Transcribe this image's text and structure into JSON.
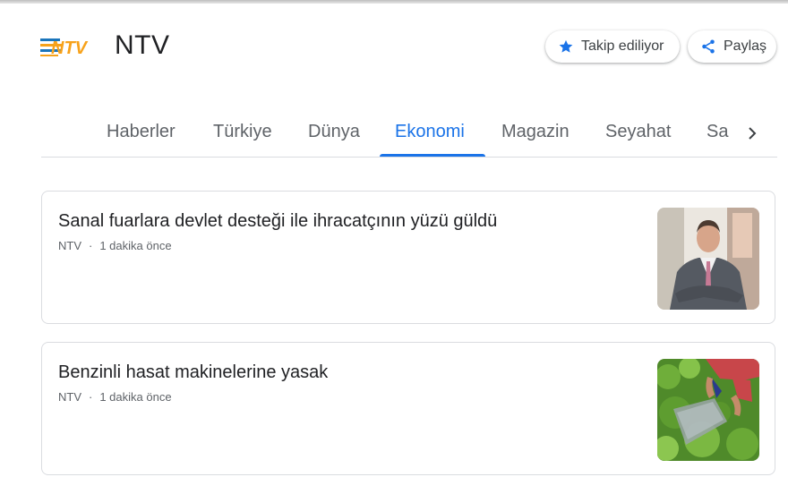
{
  "publication": {
    "name": "NTV",
    "logo_text": "NTV",
    "follow_label": "Takip ediliyor",
    "share_label": "Paylaş",
    "brand_colors": {
      "orange": "#f7a21b",
      "blue": "#1b75bb"
    }
  },
  "tabs": {
    "items": [
      "Haberler",
      "Türkiye",
      "Dünya",
      "Ekonomi",
      "Magazin",
      "Seyahat",
      "Sa"
    ],
    "active": "Ekonomi",
    "accent": "#1a73e8"
  },
  "articles": [
    {
      "headline": "Sanal fuarlara devlet desteği ile ihracatçının yüzü güldü",
      "source": "NTV",
      "separator": "·",
      "time": "1 dakika önce",
      "image": "businessman-portrait"
    },
    {
      "headline": "Benzinli hasat makinelerine yasak",
      "source": "NTV",
      "separator": "·",
      "time": "1 dakika önce",
      "image": "tea-harvest"
    }
  ],
  "icons": [
    "star-icon",
    "share-icon",
    "chevron-right-icon"
  ]
}
